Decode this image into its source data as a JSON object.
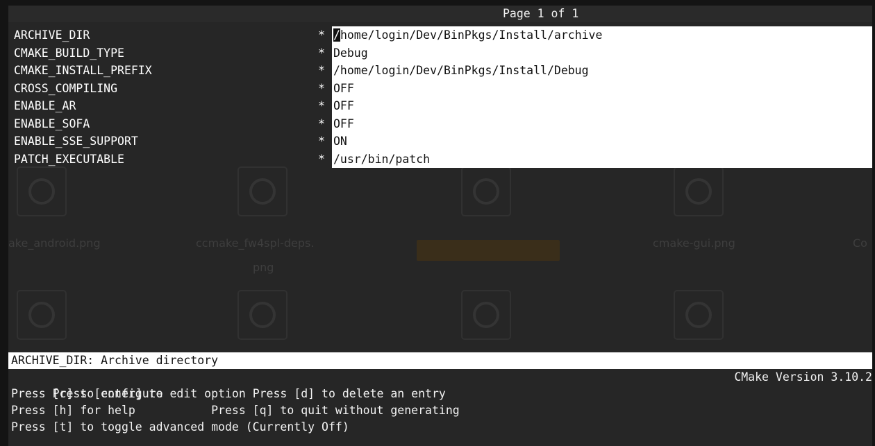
{
  "pager": {
    "label": "Page 1 of 1"
  },
  "entries": [
    {
      "key": "ARCHIVE_DIR",
      "marker": "*",
      "value_first": "/",
      "value_rest": "home/login/Dev/BinPkgs/Install/archive"
    },
    {
      "key": "CMAKE_BUILD_TYPE",
      "marker": "*",
      "value": "Debug"
    },
    {
      "key": "CMAKE_INSTALL_PREFIX",
      "marker": "*",
      "value": "/home/login/Dev/BinPkgs/Install/Debug"
    },
    {
      "key": "CROSS_COMPILING",
      "marker": "*",
      "value": "OFF"
    },
    {
      "key": "ENABLE_AR",
      "marker": "*",
      "value": "OFF"
    },
    {
      "key": "ENABLE_SOFA",
      "marker": "*",
      "value": "OFF"
    },
    {
      "key": "ENABLE_SSE_SUPPORT",
      "marker": "*",
      "value": "ON"
    },
    {
      "key": "PATCH_EXECUTABLE",
      "marker": "*",
      "value": "/usr/bin/patch"
    }
  ],
  "background_files": [
    {
      "name": "ake_android.png"
    },
    {
      "name_line1": "ccmake_fw4spl-deps.",
      "name_line2": "png"
    },
    {
      "name": "cmake-gui.png"
    },
    {
      "name": "Co"
    }
  ],
  "status": {
    "description": "ARCHIVE_DIR: Archive directory"
  },
  "help": {
    "line1": "Press [enter] to edit option Press [d] to delete an entry",
    "version": "CMake Version 3.10.2",
    "line2": "Press [c] to configure",
    "line3": "Press [h] for help           Press [q] to quit without generating",
    "line4": "Press [t] to toggle advanced mode (Currently Off)"
  },
  "colors": {
    "terminal_bg": "#262626",
    "field_bg": "#ffffff",
    "text": "#ffffff"
  }
}
